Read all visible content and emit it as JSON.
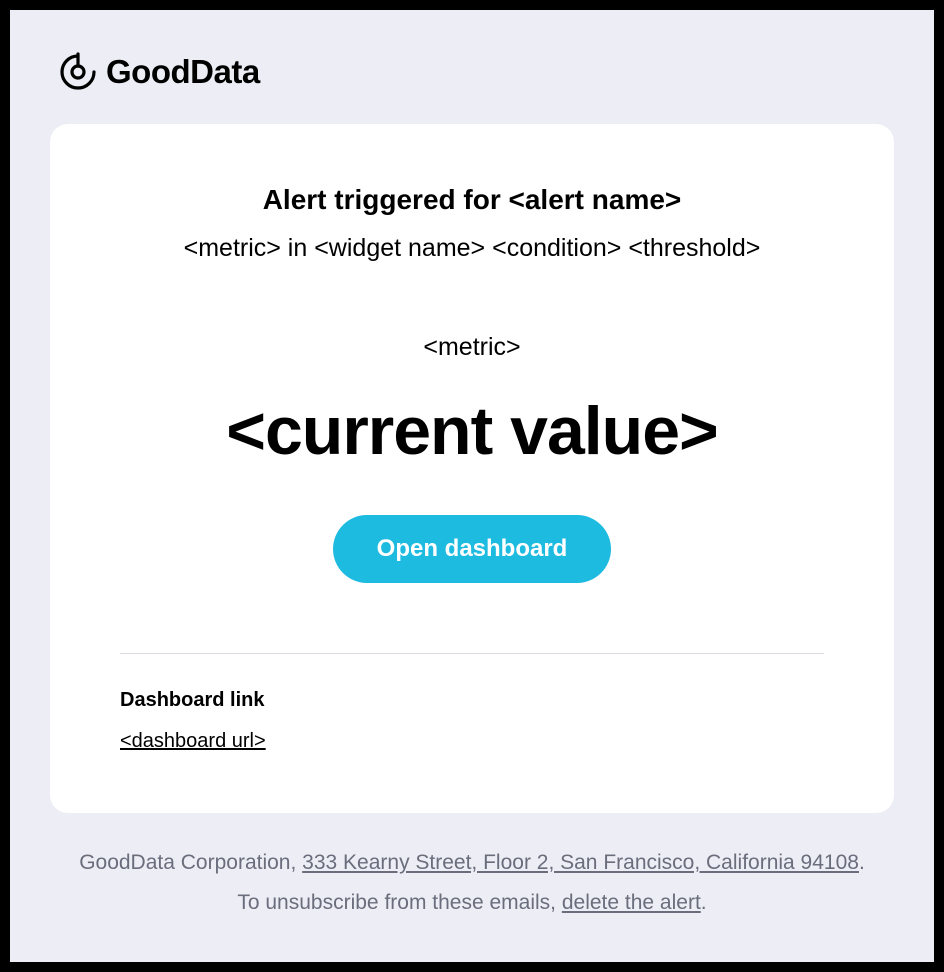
{
  "brand": {
    "name": "GoodData"
  },
  "alert": {
    "title": "Alert triggered for <alert name>",
    "description": "<metric> in <widget name> <condition> <threshold>",
    "metric_label": "<metric>",
    "current_value": "<current value>",
    "button_label": "Open dashboard"
  },
  "link_section": {
    "label": "Dashboard link",
    "url_text": "<dashboard url>"
  },
  "footer": {
    "company": "GoodData Corporation, ",
    "address": "333 Kearny Street, Floor 2, San Francisco, California 94108",
    "period1": ".",
    "unsub_prefix": "To unsubscribe from these emails, ",
    "unsub_link": "delete the alert",
    "period2": "."
  }
}
